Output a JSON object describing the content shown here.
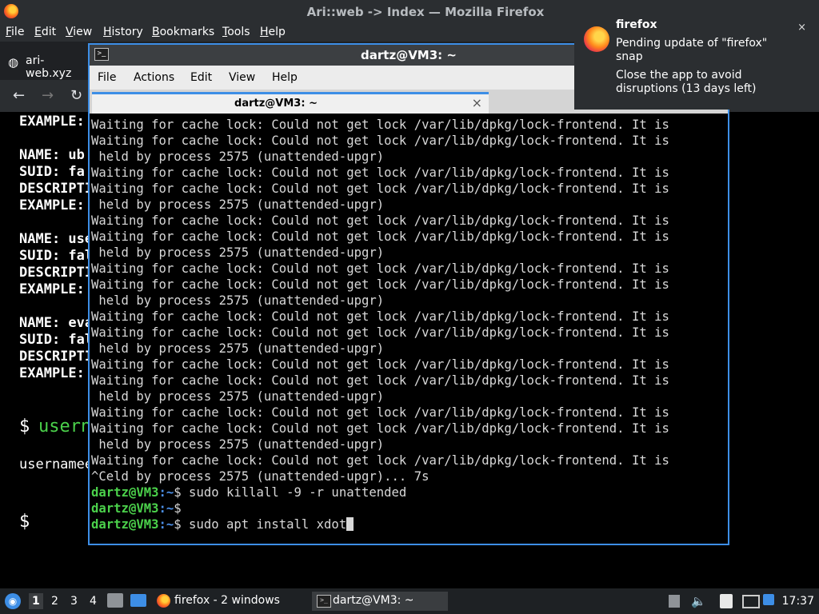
{
  "firefox": {
    "window_title": "Ari::web -> Index — Mozilla Firefox",
    "menu": [
      "File",
      "Edit",
      "View",
      "History",
      "Bookmarks",
      "Tools",
      "Help"
    ],
    "tab_title": "ari-web.xyz",
    "content": {
      "lines": [
        {
          "text": "EXAMPLE:",
          "style": "bold"
        },
        {
          "text": "NAME: ub",
          "style": "bold"
        },
        {
          "text": "SUID: fa",
          "style": "bold"
        },
        {
          "text": "DESCRIPTI",
          "style": "bold"
        },
        {
          "text": "EXAMPLE:",
          "style": "bold"
        },
        {
          "text": "NAME: use",
          "style": "bold"
        },
        {
          "text": "SUID: fal",
          "style": "bold"
        },
        {
          "text": "DESCRIPTI",
          "style": "bold"
        },
        {
          "text": "EXAMPLE:",
          "style": "bold"
        },
        {
          "text": "NAME: eva",
          "style": "bold"
        },
        {
          "text": "SUID: fal",
          "style": "bold"
        },
        {
          "text": "DESCRIPTI",
          "style": "bold"
        },
        {
          "text": "EXAMPLE:",
          "style": "bold"
        }
      ],
      "prompt_symbol": "$",
      "green_cmd": "usern",
      "output": "usernamee",
      "last_prompt": "$"
    }
  },
  "terminal": {
    "window_title": "dartz@VM3: ~",
    "menu": [
      "File",
      "Actions",
      "Edit",
      "View",
      "Help"
    ],
    "tab_label": "dartz@VM3: ~",
    "tab_close": "×",
    "lines": [
      "Waiting for cache lock: Could not get lock /var/lib/dpkg/lock-frontend. It is",
      "Waiting for cache lock: Could not get lock /var/lib/dpkg/lock-frontend. It is",
      " held by process 2575 (unattended-upgr)",
      "Waiting for cache lock: Could not get lock /var/lib/dpkg/lock-frontend. It is",
      "Waiting for cache lock: Could not get lock /var/lib/dpkg/lock-frontend. It is",
      " held by process 2575 (unattended-upgr)",
      "Waiting for cache lock: Could not get lock /var/lib/dpkg/lock-frontend. It is",
      "Waiting for cache lock: Could not get lock /var/lib/dpkg/lock-frontend. It is",
      " held by process 2575 (unattended-upgr)",
      "Waiting for cache lock: Could not get lock /var/lib/dpkg/lock-frontend. It is",
      "Waiting for cache lock: Could not get lock /var/lib/dpkg/lock-frontend. It is",
      " held by process 2575 (unattended-upgr)",
      "Waiting for cache lock: Could not get lock /var/lib/dpkg/lock-frontend. It is",
      "Waiting for cache lock: Could not get lock /var/lib/dpkg/lock-frontend. It is",
      " held by process 2575 (unattended-upgr)",
      "Waiting for cache lock: Could not get lock /var/lib/dpkg/lock-frontend. It is",
      "Waiting for cache lock: Could not get lock /var/lib/dpkg/lock-frontend. It is",
      " held by process 2575 (unattended-upgr)",
      "Waiting for cache lock: Could not get lock /var/lib/dpkg/lock-frontend. It is",
      "Waiting for cache lock: Could not get lock /var/lib/dpkg/lock-frontend. It is",
      " held by process 2575 (unattended-upgr)",
      "Waiting for cache lock: Could not get lock /var/lib/dpkg/lock-frontend. It is",
      "^Celd by process 2575 (unattended-upgr)... 7s"
    ],
    "prompt_user": "dartz@VM3",
    "prompt_path": ":~",
    "prompt_symbol": "$",
    "commands": [
      " sudo killall -9 -r unattended",
      "",
      " sudo apt install xdot"
    ]
  },
  "notification": {
    "app": "firefox",
    "line1": "Pending update of \"firefox\"",
    "line2": "snap",
    "line3": "Close the app to avoid",
    "line4": "disruptions (13 days left)",
    "close": "×"
  },
  "taskbar": {
    "workspaces": [
      "1",
      "2",
      "3",
      "4"
    ],
    "firefox_task": "firefox - 2 windows",
    "terminal_task": "dartz@VM3: ~",
    "clock": "17:37"
  },
  "colors": {
    "accent": "#3d8ee6",
    "prompt_green": "#4bd14b",
    "terminal_bg": "#000000",
    "panel_bg": "#2b2e31"
  }
}
